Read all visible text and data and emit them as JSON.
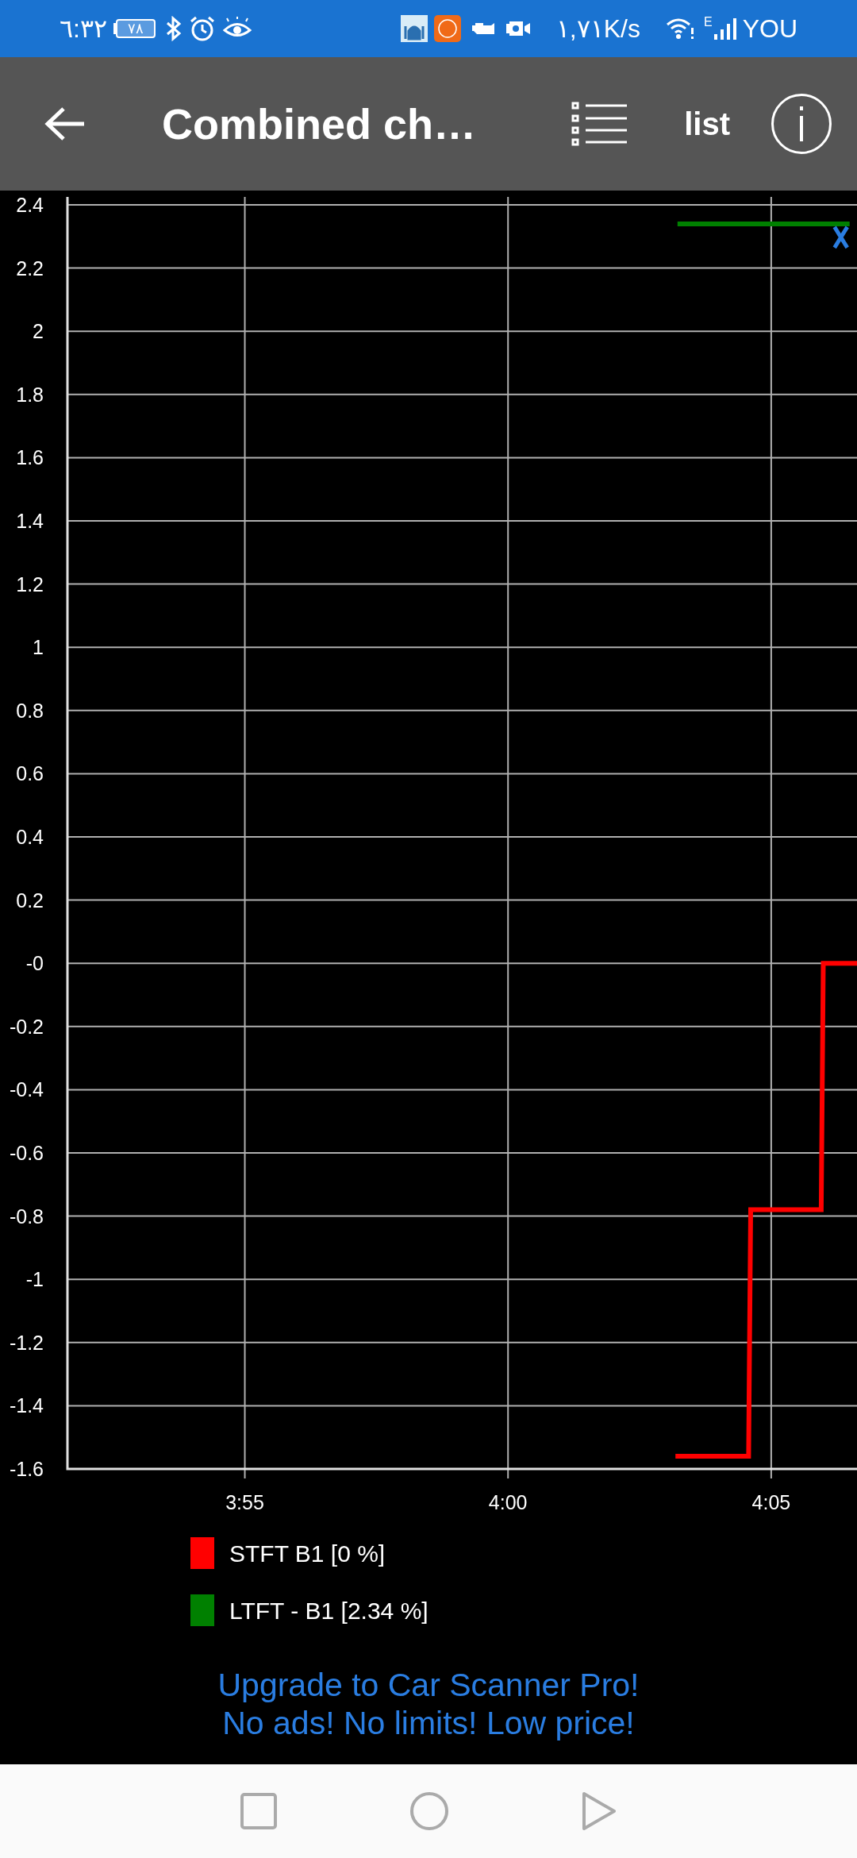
{
  "status_bar": {
    "time": "٦:٣٢",
    "battery": "٧٨",
    "network_speed": "١,٧١K/s",
    "network_type": "E",
    "carrier": "YOU"
  },
  "toolbar": {
    "title": "Combined ch…",
    "list_button": "list"
  },
  "chart": {
    "chart_data": {
      "type": "line",
      "grid": true,
      "x": [
        243.18,
        243.22,
        244.57,
        244.61,
        245.95,
        245.99,
        246.49,
        246.63
      ],
      "series": [
        {
          "name": "STFT B1 [0 %]",
          "color": "#ff0000",
          "values": [
            -1.56,
            -1.56,
            -1.56,
            -0.78,
            -0.78,
            0,
            0,
            0
          ]
        },
        {
          "name": "LTFT - B1 [2.34 %]",
          "color": "#008000",
          "values": [
            null,
            2.34,
            2.34,
            2.34,
            2.34,
            2.34,
            2.34,
            null
          ]
        }
      ],
      "xlim": [
        231.63,
        246.63
      ],
      "ylim": [
        -1.6,
        2.4
      ],
      "xticks": [
        {
          "value": 235,
          "label": "3:55"
        },
        {
          "value": 240,
          "label": "4:00"
        },
        {
          "value": 245,
          "label": "4:05"
        }
      ],
      "yticks": [
        {
          "value": 2.4,
          "label": "2.4"
        },
        {
          "value": 2.2,
          "label": "2.2"
        },
        {
          "value": 2,
          "label": "2"
        },
        {
          "value": 1.8,
          "label": "1.8"
        },
        {
          "value": 1.6,
          "label": "1.6"
        },
        {
          "value": 1.4,
          "label": "1.4"
        },
        {
          "value": 1.2,
          "label": "1.2"
        },
        {
          "value": 1,
          "label": "1"
        },
        {
          "value": 0.8,
          "label": "0.8"
        },
        {
          "value": 0.6,
          "label": "0.6"
        },
        {
          "value": 0.4,
          "label": "0.4"
        },
        {
          "value": 0.2,
          "label": "0.2"
        },
        {
          "value": 0,
          "label": "-0"
        },
        {
          "value": -0.2,
          "label": "-0.2"
        },
        {
          "value": -0.4,
          "label": "-0.4"
        },
        {
          "value": -0.6,
          "label": "-0.6"
        },
        {
          "value": -0.8,
          "label": "-0.8"
        },
        {
          "value": -1,
          "label": "-1"
        },
        {
          "value": -1.2,
          "label": "-1.2"
        },
        {
          "value": -1.4,
          "label": "-1.4"
        },
        {
          "value": -1.6,
          "label": "-1.6"
        }
      ]
    }
  },
  "ad": {
    "lines": [
      "Upgrade to Car Scanner Pro!",
      "No ads! No limits! Low price!"
    ]
  }
}
